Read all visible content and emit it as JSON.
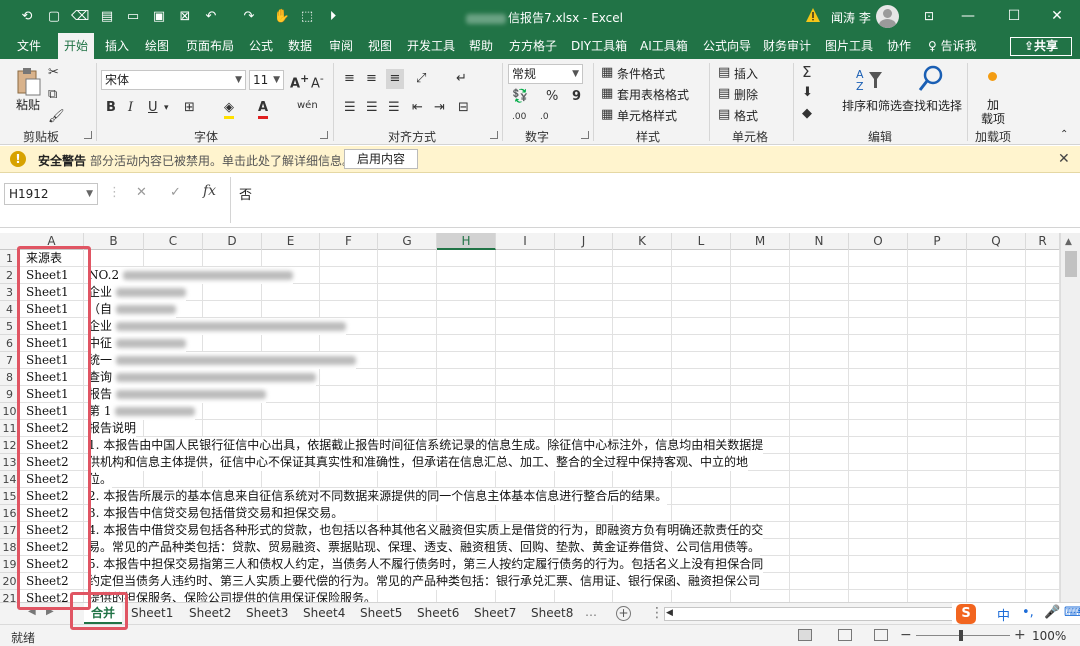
{
  "titlebar": {
    "doc_title": "信报告7.xlsx  -  Excel",
    "user_name": "闻涛 李",
    "minimize": "—",
    "maximize": "☐",
    "close": "✕"
  },
  "menu": [
    "文件",
    "开始",
    "插入",
    "绘图",
    "页面布局",
    "公式",
    "数据",
    "审阅",
    "视图",
    "开发工具",
    "帮助",
    "方方格子",
    "DIY工具箱",
    "AI工具箱",
    "公式向导",
    "财务审计",
    "图片工具",
    "协作"
  ],
  "active_menu": "开始",
  "tell_me": "告诉我",
  "share": "共享",
  "ribbon": {
    "paste": "粘贴",
    "clipboard": "剪贴板",
    "font_name": "宋体",
    "font_size": "11",
    "font_group": "字体",
    "align_group": "对齐方式",
    "number_format": "常规",
    "number_group": "数字",
    "cond_format": "条件格式",
    "table_format": "套用表格格式",
    "cell_style": "单元格样式",
    "styles_group": "样式",
    "insert": "插入",
    "delete": "删除",
    "format": "格式",
    "cells_group": "单元格",
    "sort_filter": "排序和筛选",
    "find_select": "查找和选择",
    "edit_group": "编辑",
    "addin_line1": "加",
    "addin_line2": "载项",
    "addin_group": "加载项"
  },
  "security": {
    "title": "安全警告",
    "message": "部分活动内容已被禁用。单击此处了解详细信息。",
    "button": "启用内容"
  },
  "formula_bar": {
    "name_box": "H1912",
    "content": "否"
  },
  "columns": [
    "A",
    "B",
    "C",
    "D",
    "E",
    "F",
    "G",
    "H",
    "I",
    "J",
    "K",
    "L",
    "M",
    "N",
    "O",
    "P",
    "Q",
    "R"
  ],
  "selected_column": "H",
  "rows": [
    {
      "n": "1",
      "a": "来源表",
      "b": ""
    },
    {
      "n": "2",
      "a": "Sheet1",
      "b": "NO.2"
    },
    {
      "n": "3",
      "a": "Sheet1",
      "b": "企业"
    },
    {
      "n": "4",
      "a": "Sheet1",
      "b": "（自"
    },
    {
      "n": "5",
      "a": "Sheet1",
      "b": "企业"
    },
    {
      "n": "6",
      "a": "Sheet1",
      "b": "中征"
    },
    {
      "n": "7",
      "a": "Sheet1",
      "b": "统一"
    },
    {
      "n": "8",
      "a": "Sheet1",
      "b": "查询"
    },
    {
      "n": "9",
      "a": "Sheet1",
      "b": "报告"
    },
    {
      "n": "10",
      "a": "Sheet1",
      "b": "第 1"
    },
    {
      "n": "11",
      "a": "Sheet2",
      "b": "报告说明"
    },
    {
      "n": "12",
      "a": "Sheet2",
      "b": "1. 本报告由中国人民银行征信中心出具，依据截止报告时间征信系统记录的信息生成。除征信中心标注外，信息均由相关数据提"
    },
    {
      "n": "13",
      "a": "Sheet2",
      "b": "供机构和信息主体提供，征信中心不保证其真实性和准确性，但承诺在信息汇总、加工、整合的全过程中保持客观、中立的地"
    },
    {
      "n": "14",
      "a": "Sheet2",
      "b": "位。"
    },
    {
      "n": "15",
      "a": "Sheet2",
      "b": "2. 本报告所展示的基本信息来自征信系统对不同数据来源提供的同一个信息主体基本信息进行整合后的结果。"
    },
    {
      "n": "16",
      "a": "Sheet2",
      "b": "3. 本报告中信贷交易包括借贷交易和担保交易。"
    },
    {
      "n": "17",
      "a": "Sheet2",
      "b": "4. 本报告中借贷交易包括各种形式的贷款，也包括以各种其他名义融资但实质上是借贷的行为，即融资方负有明确还款责任的交"
    },
    {
      "n": "18",
      "a": "Sheet2",
      "b": "易。常见的产品种类包括：贷款、贸易融资、票据贴现、保理、透支、融资租赁、回购、垫款、黄金证券借贷、公司信用债等。"
    },
    {
      "n": "19",
      "a": "Sheet2",
      "b": "5. 本报告中担保交易指第三人和债权人约定，当债务人不履行债务时，第三人按约定履行债务的行为。包括名义上没有担保合同"
    },
    {
      "n": "20",
      "a": "Sheet2",
      "b": "约定但当债务人违约时、第三人实质上要代偿的行为。常见的产品种类包括：银行承兑汇票、信用证、银行保函、融资担保公司"
    },
    {
      "n": "21",
      "a": "Sheet2",
      "b": "提供的担保服务、保险公司提供的信用保证保险服务。"
    }
  ],
  "sheet_tabs": [
    "合并",
    "Sheet1",
    "Sheet2",
    "Sheet3",
    "Sheet4",
    "Sheet5",
    "Sheet6",
    "Sheet7",
    "Sheet8"
  ],
  "active_tab": "合并",
  "ime": {
    "lang": "中"
  },
  "status": {
    "text": "就绪",
    "zoom": "100%"
  },
  "colors": {
    "excel_green": "#217346",
    "annotation_red": "#e05563",
    "warning_bg": "#fff4ce"
  }
}
